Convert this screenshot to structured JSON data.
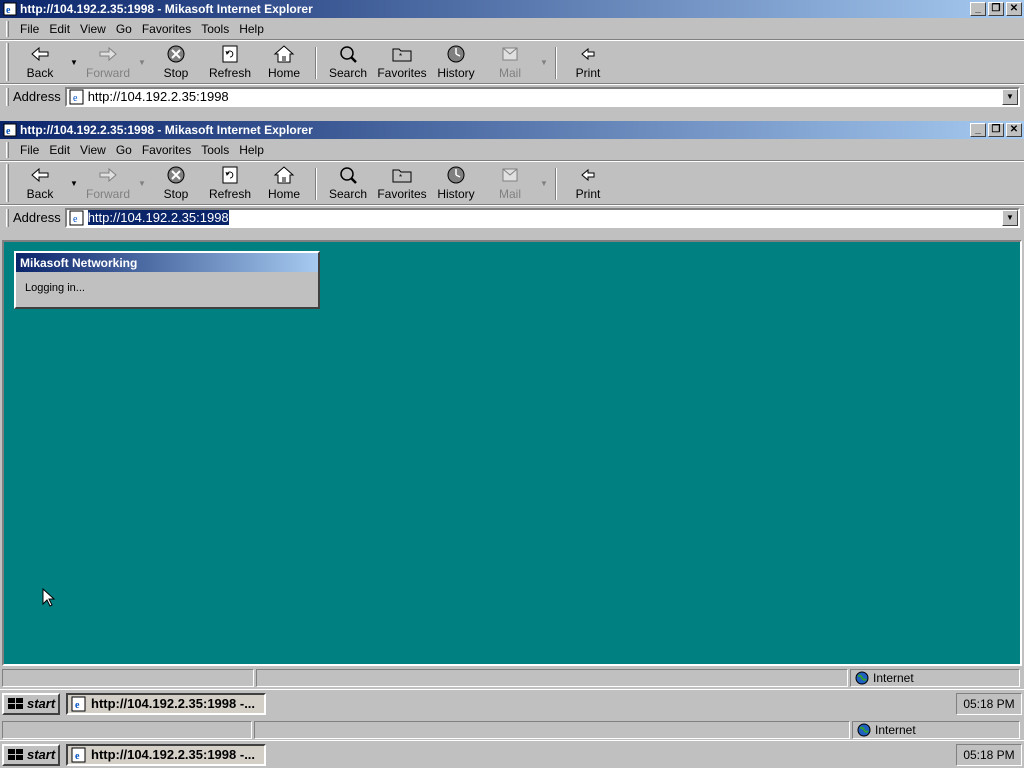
{
  "outer_window": {
    "title": "http://104.192.2.35:1998 - Mikasoft Internet Explorer",
    "address": "http://104.192.2.35:1998",
    "status_zone": "Internet"
  },
  "inner_window": {
    "title": "http://104.192.2.35:1998 - Mikasoft Internet Explorer",
    "address": "http://104.192.2.35:1998",
    "status_zone": "Internet"
  },
  "menu": [
    "File",
    "Edit",
    "View",
    "Go",
    "Favorites",
    "Tools",
    "Help"
  ],
  "toolbar": {
    "back": "Back",
    "forward": "Forward",
    "stop": "Stop",
    "refresh": "Refresh",
    "home": "Home",
    "search": "Search",
    "favorites": "Favorites",
    "history": "History",
    "mail": "Mail",
    "print": "Print"
  },
  "address_label": "Address",
  "dialog": {
    "title": "Mikasoft Networking",
    "message": "Logging in..."
  },
  "taskbar": {
    "start_label": "start",
    "task_label": "http://104.192.2.35:1998 -...",
    "clock": "05:18 PM"
  },
  "colors": {
    "desktop": "#008080",
    "titlebar_start": "#0a246a",
    "titlebar_end": "#a6caf0",
    "chrome": "#c0c0c0"
  }
}
